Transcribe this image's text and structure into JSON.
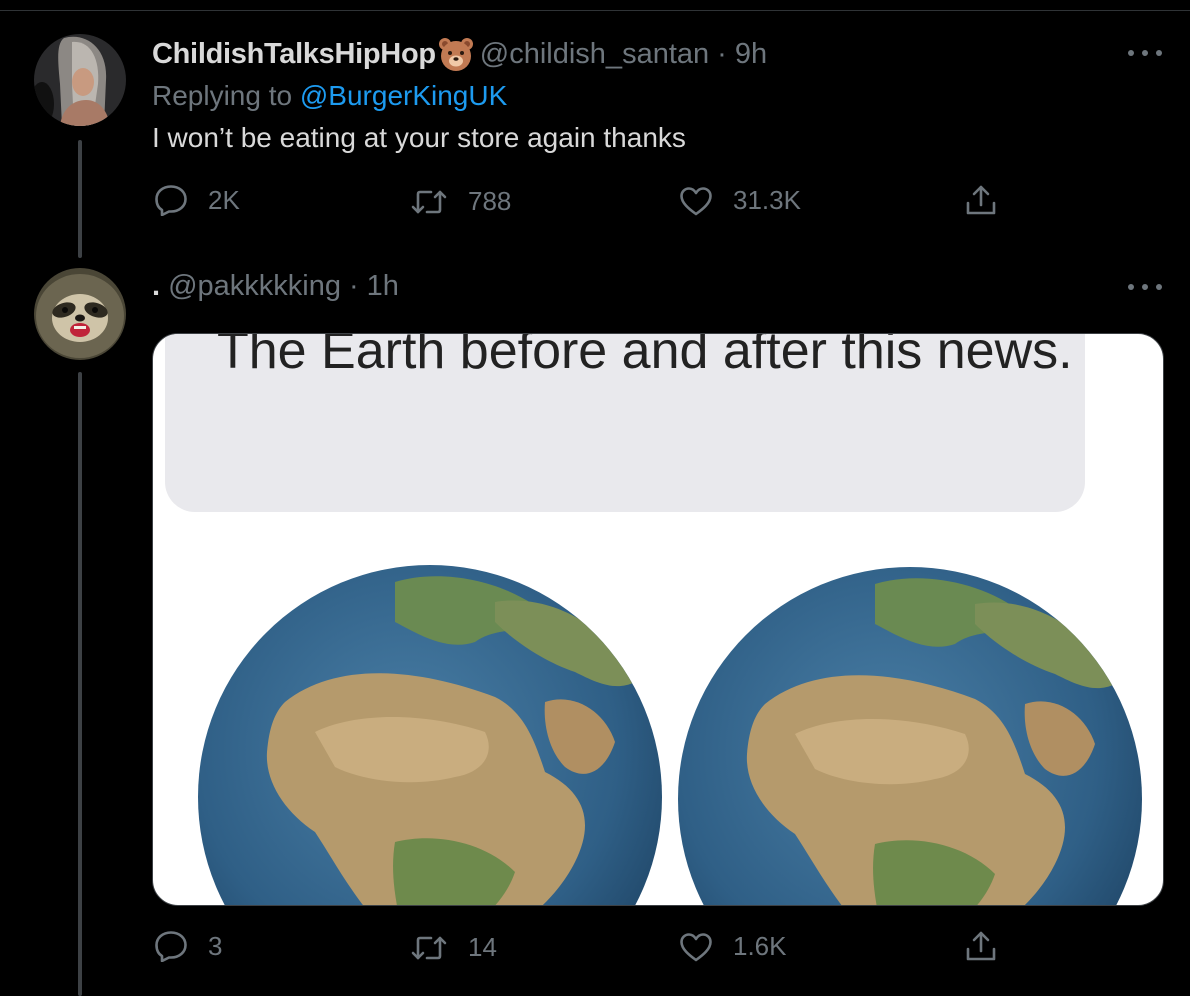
{
  "tweets": [
    {
      "display_name": "ChildishTalksHipHop",
      "name_emoji": "bear-face-emoji",
      "handle": "@childish_santan",
      "separator": "·",
      "time": "9h",
      "replying_prefix": "Replying to",
      "replying_to": "@BurgerKingUK",
      "text": "I won’t be eating at your store again thanks",
      "replies": "2K",
      "retweets": "788",
      "likes": "31.3K"
    },
    {
      "display_name": ".",
      "handle": "@pakkkkking",
      "separator": "·",
      "time": "1h",
      "image_caption": "The Earth before and after this news.",
      "replies": "3",
      "retweets": "14",
      "likes": "1.6K"
    }
  ],
  "icons": {
    "reply": "speech-bubble-icon",
    "retweet": "retweet-arrows-icon",
    "like": "heart-icon",
    "share": "share-upload-icon",
    "more": "three-dots-icon"
  },
  "colors": {
    "background": "#000000",
    "text": "#d9d9d9",
    "muted": "#6e767d",
    "mention": "#1d9bf0",
    "thread_line": "#3d4145"
  }
}
